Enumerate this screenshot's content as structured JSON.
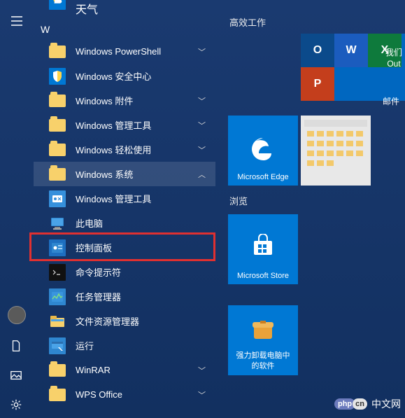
{
  "partial_top_app": "天气",
  "letter_header": "W",
  "apps": [
    {
      "label": "Windows PowerShell",
      "icon": "folder",
      "expand": true
    },
    {
      "label": "Windows 安全中心",
      "icon": "shield",
      "expand": false
    },
    {
      "label": "Windows 附件",
      "icon": "folder",
      "expand": true
    },
    {
      "label": "Windows 管理工具",
      "icon": "folder",
      "expand": true
    },
    {
      "label": "Windows 轻松使用",
      "icon": "folder",
      "expand": true
    },
    {
      "label": "Windows 系统",
      "icon": "folder",
      "expand": true,
      "expanded": true,
      "children": [
        {
          "label": "Windows 管理工具",
          "icon": "admintools"
        },
        {
          "label": "此电脑",
          "icon": "pc"
        },
        {
          "label": "控制面板",
          "icon": "cp",
          "boxed": true
        },
        {
          "label": "命令提示符",
          "icon": "cmd"
        },
        {
          "label": "任务管理器",
          "icon": "tm"
        },
        {
          "label": "文件资源管理器",
          "icon": "fe"
        },
        {
          "label": "运行",
          "icon": "run"
        }
      ]
    },
    {
      "label": "WinRAR",
      "icon": "folder",
      "expand": true
    },
    {
      "label": "WPS Office",
      "icon": "folder",
      "expand": true
    }
  ],
  "tiles": {
    "group1_title": "高效工作",
    "edge_label": "Microsoft Edge",
    "right_stub_line1": "我们",
    "right_stub_line2": "Out",
    "mail_label": "邮件",
    "group2_title": "浏览",
    "store_label": "Microsoft Store",
    "uninstall_line1": "强力卸载电脑中",
    "uninstall_line2": "的软件"
  },
  "office": {
    "outlook": "O",
    "word": "W",
    "excel": "X",
    "ppt": "P"
  },
  "watermark": {
    "p1": "php",
    "p2": "cn",
    "text": "中文网"
  }
}
